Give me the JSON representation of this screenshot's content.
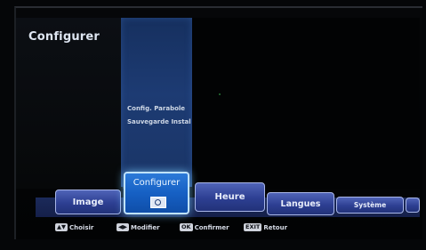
{
  "panel": {
    "title": "Configurer"
  },
  "submenu": {
    "items": [
      "Config. Parabole",
      "Sauvegarde Instal"
    ]
  },
  "tabs": {
    "image": "Image",
    "configurer": "Configurer",
    "heure": "Heure",
    "langues": "Langues",
    "systeme": "Système"
  },
  "footer": {
    "choisir_key": "▲▼",
    "choisir": "Choisir",
    "modifier_key": "◀▶",
    "modifier": "Modifier",
    "confirmer_key": "OK",
    "confirmer": "Confirmer",
    "retour_key": "EXIT",
    "retour": "Retour"
  },
  "colors": {
    "menu_blue": "#1d3b73",
    "tab_blue": "#2d3f92",
    "active_tab": "#1660c4"
  }
}
